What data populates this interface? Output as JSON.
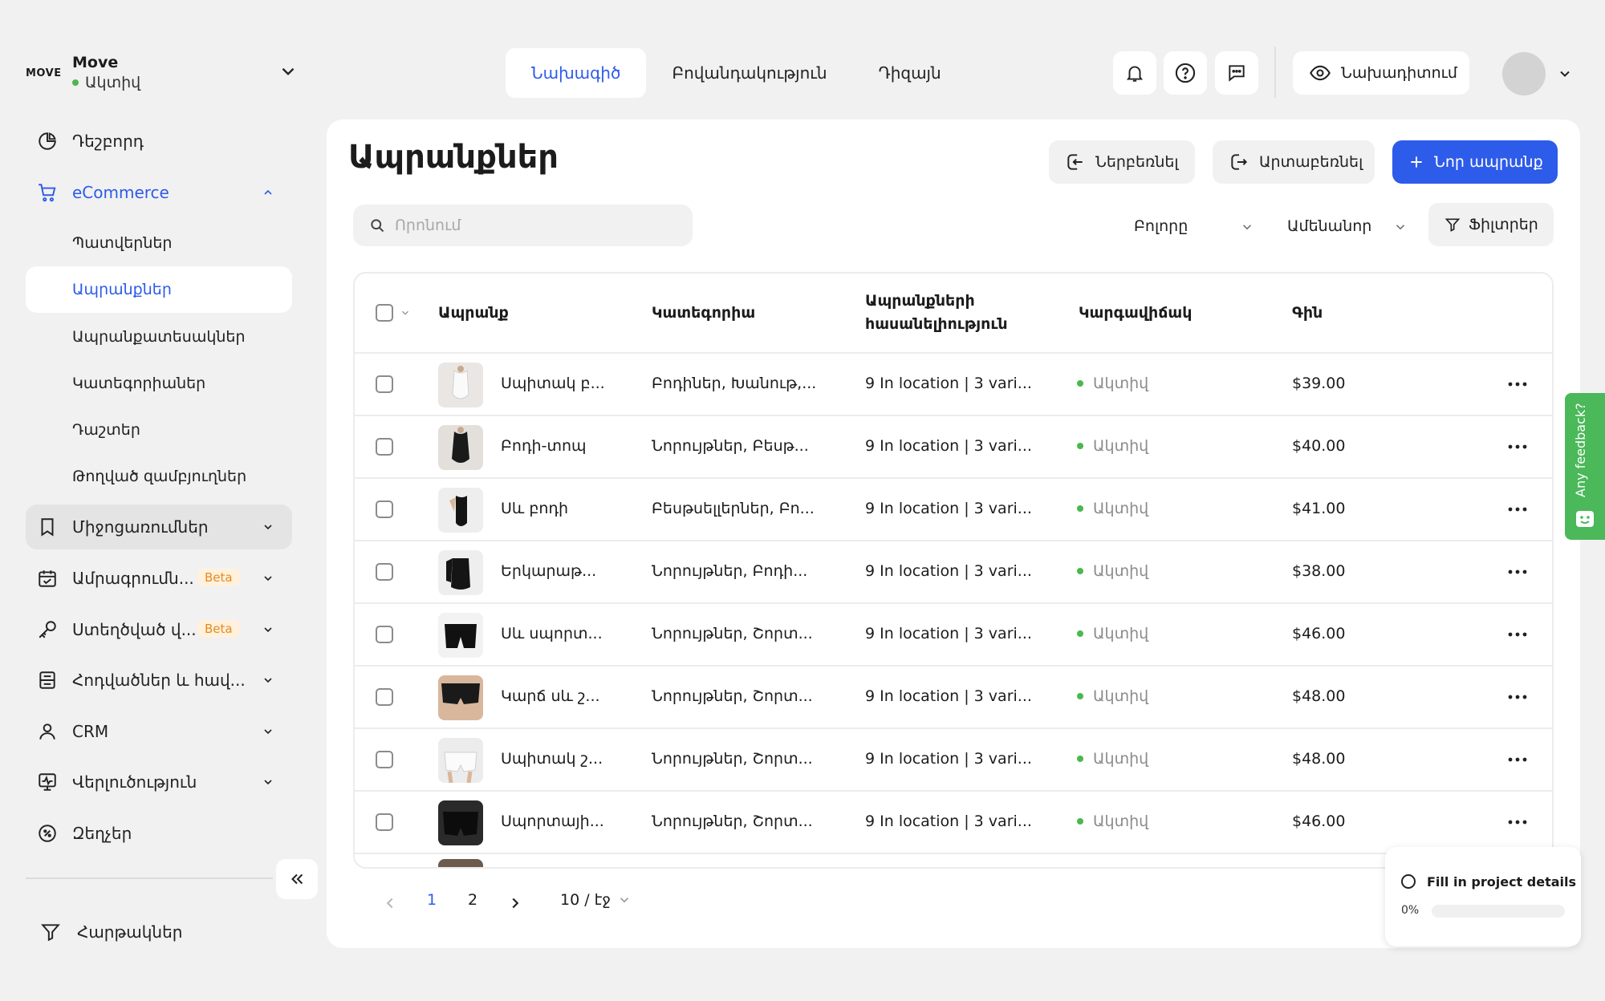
{
  "workspace": {
    "logo": "MOVE",
    "name": "Move",
    "status": "Ակտիվ"
  },
  "sidebar": {
    "dashboard": "Դեշբորդ",
    "ecommerce": "eCommerce",
    "ecommerce_sub": [
      "Պատվերներ",
      "Ապրանքներ",
      "Ապրանքատեսակներ",
      "Կատեգորիաներ",
      "Դաշտեր",
      "Թողված զամբյուղներ"
    ],
    "events": "Միջոցառումներ",
    "bookings": "Ամրագրումն...",
    "bookings_badge": "Beta",
    "custom": "Ստեղծված վ...",
    "custom_badge": "Beta",
    "posts": "Հոդվածներ և հավ...",
    "crm": "CRM",
    "analytics": "Վերլուծություն",
    "discounts": "Զեղչեր",
    "bottom": "Հարթակներ"
  },
  "topbar": {
    "tabs": [
      "Նախագիծ",
      "Բովանդակություն",
      "Դիզայն"
    ],
    "preview_label": "Նախադիտում"
  },
  "main": {
    "title": "Ապրանքներ",
    "import_label": "Ներբեռնել",
    "export_label": "Արտաբեռնել",
    "new_label": "Նոր ապրանք",
    "search_placeholder": "Որոնում",
    "filter_all": "Բոլորը",
    "sort_label": "Ամենանոր",
    "filters_label": "Ֆիլտրեր"
  },
  "table": {
    "columns": [
      "Ապրանք",
      "Կատեգորիա",
      "Ապրանքների հասանելիություն",
      "Կարգավիճակ",
      "Գին"
    ],
    "rows": [
      {
        "name": "Սպիտակ բ...",
        "category": "Բոդիներ, Խանութ,...",
        "availability": "9 In location | 3 vari...",
        "status": "Ակտիվ",
        "price": "$39.00"
      },
      {
        "name": "Բոդի-տոպ",
        "category": "Նորույթներ, Բեսթ...",
        "availability": "9 In location | 3 vari...",
        "status": "Ակտիվ",
        "price": "$40.00"
      },
      {
        "name": "Սև բոդի",
        "category": "Բեսթսելլերներ, Բո...",
        "availability": "9 In location | 3 vari...",
        "status": "Ակտիվ",
        "price": "$41.00"
      },
      {
        "name": "Երկարաթ...",
        "category": "Նորույթներ, Բոդի...",
        "availability": "9 In location | 3 vari...",
        "status": "Ակտիվ",
        "price": "$38.00"
      },
      {
        "name": "Սև սպորտ...",
        "category": "Նորույթներ, Շորտ...",
        "availability": "9 In location | 3 vari...",
        "status": "Ակտիվ",
        "price": "$46.00"
      },
      {
        "name": "Կարճ սև շ...",
        "category": "Նորույթներ, Շորտ...",
        "availability": "9 In location | 3 vari...",
        "status": "Ակտիվ",
        "price": "$48.00"
      },
      {
        "name": "Սպիտակ շ...",
        "category": "Նորույթներ, Շորտ...",
        "availability": "9 In location | 3 vari...",
        "status": "Ակտիվ",
        "price": "$48.00"
      },
      {
        "name": "Սպորտայի...",
        "category": "Նորույթներ, Շորտ...",
        "availability": "9 In location | 3 vari...",
        "status": "Ակտիվ",
        "price": "$46.00"
      }
    ]
  },
  "pagination": {
    "pages": [
      "1",
      "2"
    ],
    "current": "1",
    "per_page": "10 / էջ"
  },
  "feedback": {
    "label": "Any feedback?"
  },
  "setup": {
    "title": "Fill in project details",
    "percent": "0%",
    "progress": 0
  },
  "colors": {
    "accent": "#2d5bea",
    "active_dot": "#4ab84e",
    "feedback": "#4bb85a",
    "beta_bg": "#fff1dc",
    "beta_fg": "#e68a22"
  }
}
